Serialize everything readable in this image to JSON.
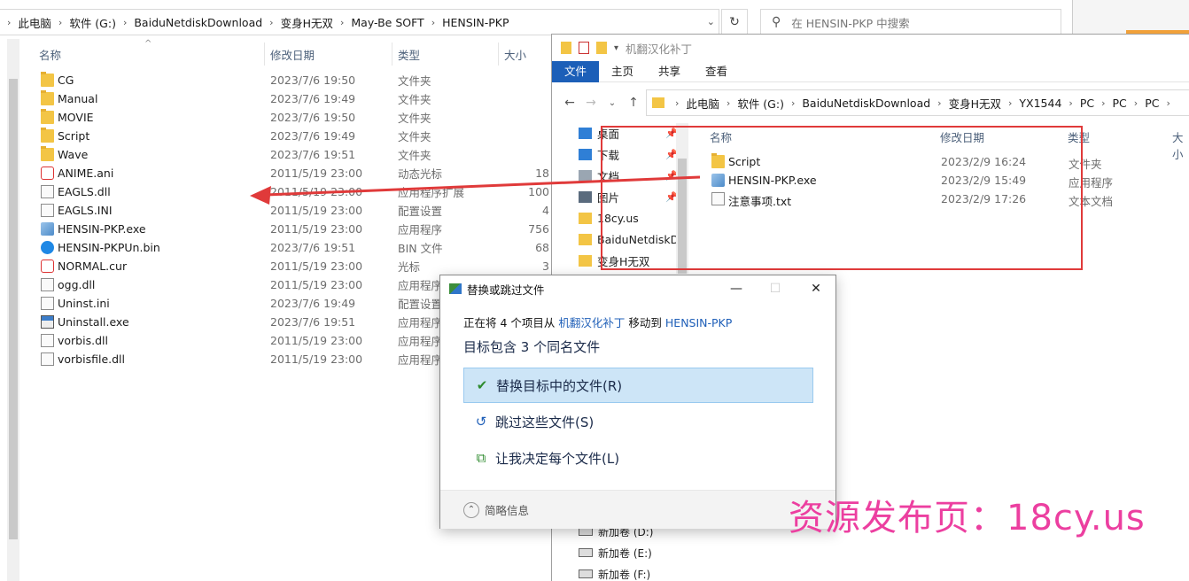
{
  "left": {
    "breadcrumb": [
      "此电脑",
      "软件 (G:)",
      "BaiduNetdiskDownload",
      "变身H无双",
      "May-Be SOFT",
      "HENSIN-PKP"
    ],
    "search_placeholder": "在 HENSIN-PKP 中搜索",
    "columns": {
      "name": "名称",
      "date": "修改日期",
      "type": "类型",
      "size": "大小"
    },
    "files": [
      {
        "name": "CG",
        "date": "2023/7/6 19:50",
        "type": "文件夹",
        "size": "",
        "icon": "folder-icon"
      },
      {
        "name": "Manual",
        "date": "2023/7/6 19:49",
        "type": "文件夹",
        "size": "",
        "icon": "folder-icon"
      },
      {
        "name": "MOVIE",
        "date": "2023/7/6 19:50",
        "type": "文件夹",
        "size": "",
        "icon": "folder-icon"
      },
      {
        "name": "Script",
        "date": "2023/7/6 19:49",
        "type": "文件夹",
        "size": "",
        "icon": "folder-icon"
      },
      {
        "name": "Wave",
        "date": "2023/7/6 19:51",
        "type": "文件夹",
        "size": "",
        "icon": "folder-icon"
      },
      {
        "name": "ANIME.ani",
        "date": "2011/5/19 23:00",
        "type": "动态光标",
        "size": "18",
        "icon": "cursor-icon"
      },
      {
        "name": "EAGLS.dll",
        "date": "2011/5/19 23:00",
        "type": "应用程序扩展",
        "size": "100",
        "icon": "dll-icon"
      },
      {
        "name": "EAGLS.INI",
        "date": "2011/5/19 23:00",
        "type": "配置设置",
        "size": "4",
        "icon": "ini-icon"
      },
      {
        "name": "HENSIN-PKP.exe",
        "date": "2011/5/19 23:00",
        "type": "应用程序",
        "size": "756",
        "icon": "exe-icon"
      },
      {
        "name": "HENSIN-PKPUn.bin",
        "date": "2023/7/6 19:51",
        "type": "BIN 文件",
        "size": "68",
        "icon": "bin-icon"
      },
      {
        "name": "NORMAL.cur",
        "date": "2011/5/19 23:00",
        "type": "光标",
        "size": "3",
        "icon": "cursor-icon"
      },
      {
        "name": "ogg.dll",
        "date": "2011/5/19 23:00",
        "type": "应用程序",
        "size": "",
        "icon": "dll-icon"
      },
      {
        "name": "Uninst.ini",
        "date": "2023/7/6 19:49",
        "type": "配置设置",
        "size": "",
        "icon": "ini-icon"
      },
      {
        "name": "Uninstall.exe",
        "date": "2023/7/6 19:51",
        "type": "应用程序",
        "size": "",
        "icon": "installer-icon"
      },
      {
        "name": "vorbis.dll",
        "date": "2011/5/19 23:00",
        "type": "应用程序",
        "size": "",
        "icon": "dll-icon"
      },
      {
        "name": "vorbisfile.dll",
        "date": "2011/5/19 23:00",
        "type": "应用程序",
        "size": "",
        "icon": "dll-icon"
      }
    ]
  },
  "right": {
    "title": "机翻汉化补丁",
    "ribbon_tabs": [
      "文件",
      "主页",
      "共享",
      "查看"
    ],
    "breadcrumb": [
      "此电脑",
      "软件 (G:)",
      "BaiduNetdiskDownload",
      "变身H无双",
      "YX1544",
      "PC",
      "PC",
      "PC"
    ],
    "tree": [
      {
        "label": "桌面",
        "pinned": true,
        "icon": "desktop-icon"
      },
      {
        "label": "下载",
        "pinned": true,
        "icon": "download-icon"
      },
      {
        "label": "文档",
        "pinned": true,
        "icon": "document-icon"
      },
      {
        "label": "图片",
        "pinned": true,
        "icon": "picture-icon"
      },
      {
        "label": "18cy.us",
        "pinned": false,
        "icon": "folder-icon"
      },
      {
        "label": "BaiduNetdiskD",
        "pinned": false,
        "icon": "folder-icon"
      },
      {
        "label": "变身H无双",
        "pinned": false,
        "icon": "folder-icon"
      }
    ],
    "drives": [
      "新加卷 (D:)",
      "新加卷 (E:)",
      "新加卷 (F:)"
    ],
    "columns": {
      "name": "名称",
      "date": "修改日期",
      "type": "类型",
      "size": "大小"
    },
    "files": [
      {
        "name": "Script",
        "date": "2023/2/9 16:24",
        "type": "文件夹",
        "icon": "folder-icon"
      },
      {
        "name": "HENSIN-PKP.exe",
        "date": "2023/2/9 15:49",
        "type": "应用程序",
        "icon": "exe-icon"
      },
      {
        "name": "注意事项.txt",
        "date": "2023/2/9 17:26",
        "type": "文本文档",
        "icon": "text-file-icon"
      }
    ]
  },
  "dialog": {
    "title": "替换或跳过文件",
    "line1_prefix": "正在将 4 个项目从",
    "source": "机翻汉化补丁",
    "line1_mid": "移动到",
    "dest": "HENSIN-PKP",
    "line2": "目标包含 3 个同名文件",
    "options": [
      {
        "label": "替换目标中的文件(R)",
        "icon": "checkmark-icon",
        "glyph": "✔",
        "color": "#2e8b2e"
      },
      {
        "label": "跳过这些文件(S)",
        "icon": "skip-icon",
        "glyph": "↺",
        "color": "#1f5fb8"
      },
      {
        "label": "让我决定每个文件(L)",
        "icon": "compare-icon",
        "glyph": "⧉",
        "color": "#2e8b2e"
      }
    ],
    "footer": "简略信息"
  },
  "watermark": "资源发布页：18cy.us",
  "colors": {
    "accent": "#1c5fb8",
    "highlight_box": "#e03a3a",
    "watermark": "#ec3fa0",
    "selected_option": "#cde5f7"
  }
}
